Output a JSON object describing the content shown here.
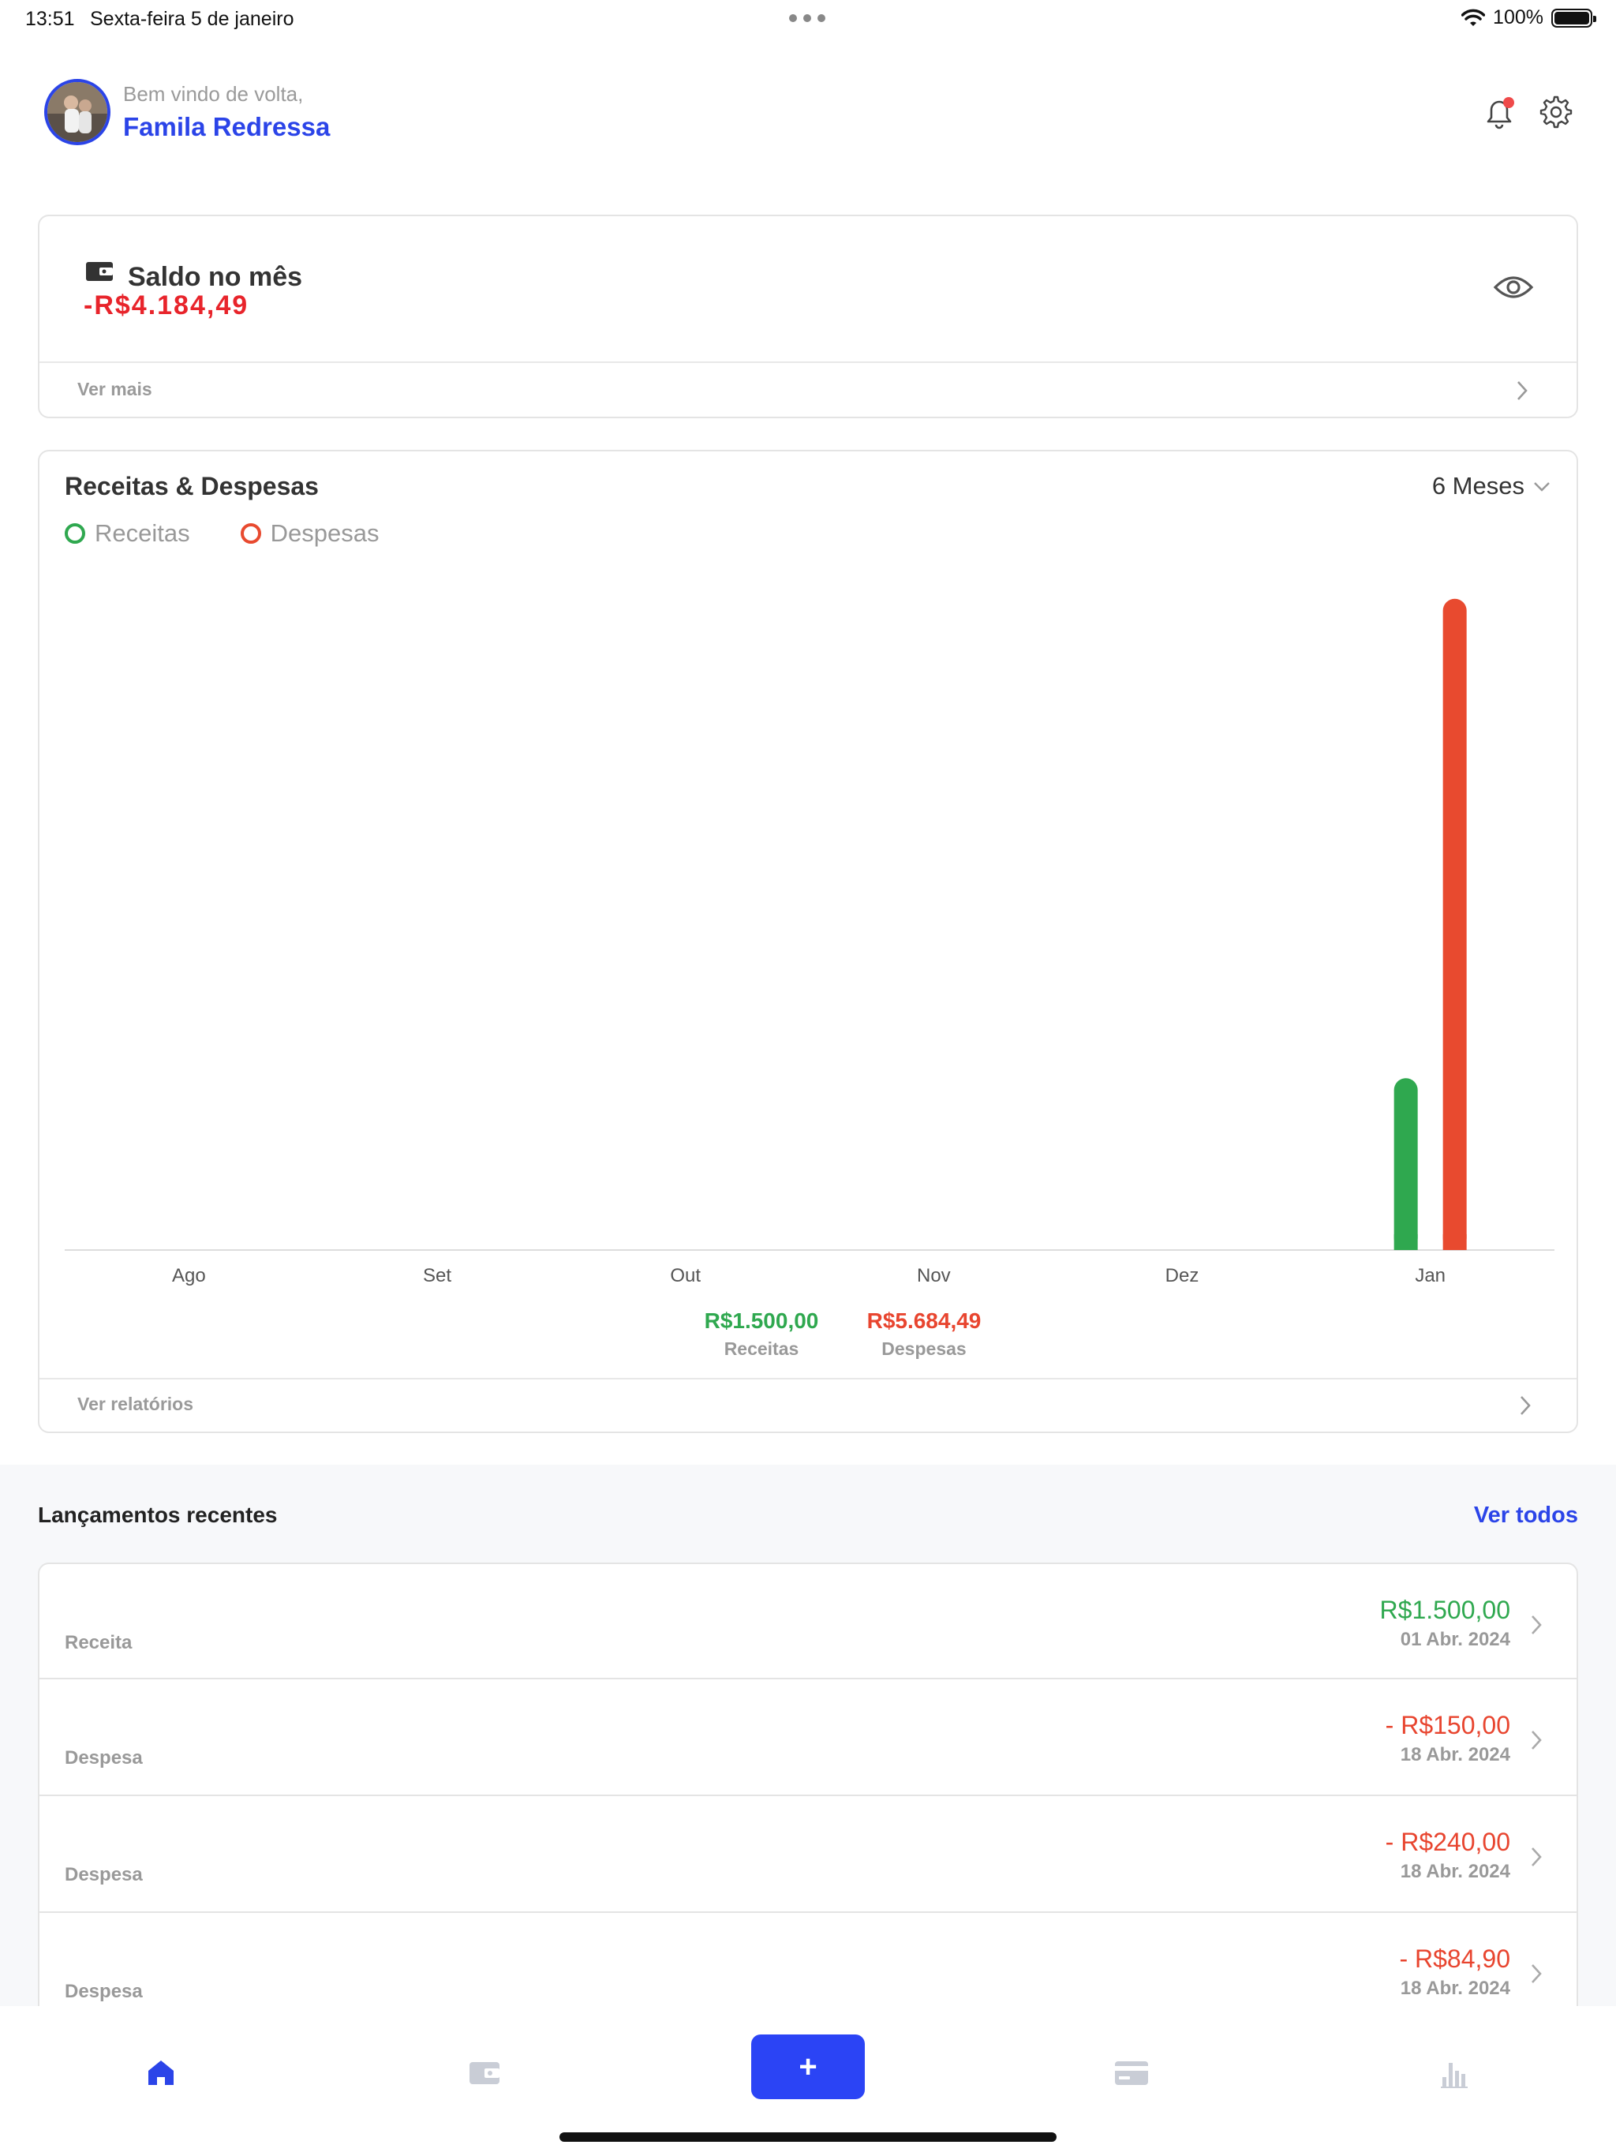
{
  "status_bar": {
    "time": "13:51",
    "date": "Sexta-feira 5 de janeiro",
    "battery": "100%"
  },
  "header": {
    "greeting": "Bem vindo de volta,",
    "user_name": "Famila Redressa"
  },
  "saldo": {
    "title": "Saldo no mês",
    "value": "-R$4.184,49",
    "footer": "Ver mais"
  },
  "chart_card": {
    "title": "Receitas & Despesas",
    "period": "6 Meses",
    "footer": "Ver relatórios",
    "totals": {
      "receitas_value": "R$1.500,00",
      "receitas_label": "Receitas",
      "despesas_value": "R$5.684,49",
      "despesas_label": "Despesas"
    }
  },
  "chart_data": {
    "type": "bar",
    "categories": [
      "Ago",
      "Set",
      "Out",
      "Nov",
      "Dez",
      "Jan"
    ],
    "series": [
      {
        "name": "Receitas",
        "values": [
          0,
          0,
          0,
          0,
          0,
          1500
        ],
        "color": "#2fa84f"
      },
      {
        "name": "Despesas",
        "values": [
          0,
          0,
          0,
          0,
          0,
          5684.49
        ],
        "color": "#e84a2f"
      }
    ],
    "ylim": [
      0,
      5800
    ],
    "grid": false,
    "legend": "top-left"
  },
  "recent": {
    "title": "Lançamentos recentes",
    "see_all": "Ver todos",
    "items": [
      {
        "type": "Receita",
        "amount": "R$1.500,00",
        "date": "01 Abr. 2024",
        "color": "#2fa84f"
      },
      {
        "type": "Despesa",
        "amount": "- R$150,00",
        "date": "18 Abr. 2024",
        "color": "#e8452f"
      },
      {
        "type": "Despesa",
        "amount": "- R$240,00",
        "date": "18 Abr. 2024",
        "color": "#e8452f"
      },
      {
        "type": "Despesa",
        "amount": "- R$84,90",
        "date": "18 Abr. 2024",
        "color": "#e8452f"
      }
    ]
  },
  "bottom_nav": {
    "add_label": "+",
    "items": [
      "home-icon",
      "wallet-icon",
      "card-icon",
      "chart-icon"
    ]
  },
  "colors": {
    "accent": "#2b44e8",
    "income": "#2fa84f",
    "expense": "#e8452f",
    "saldo_negative": "#e8242b"
  }
}
